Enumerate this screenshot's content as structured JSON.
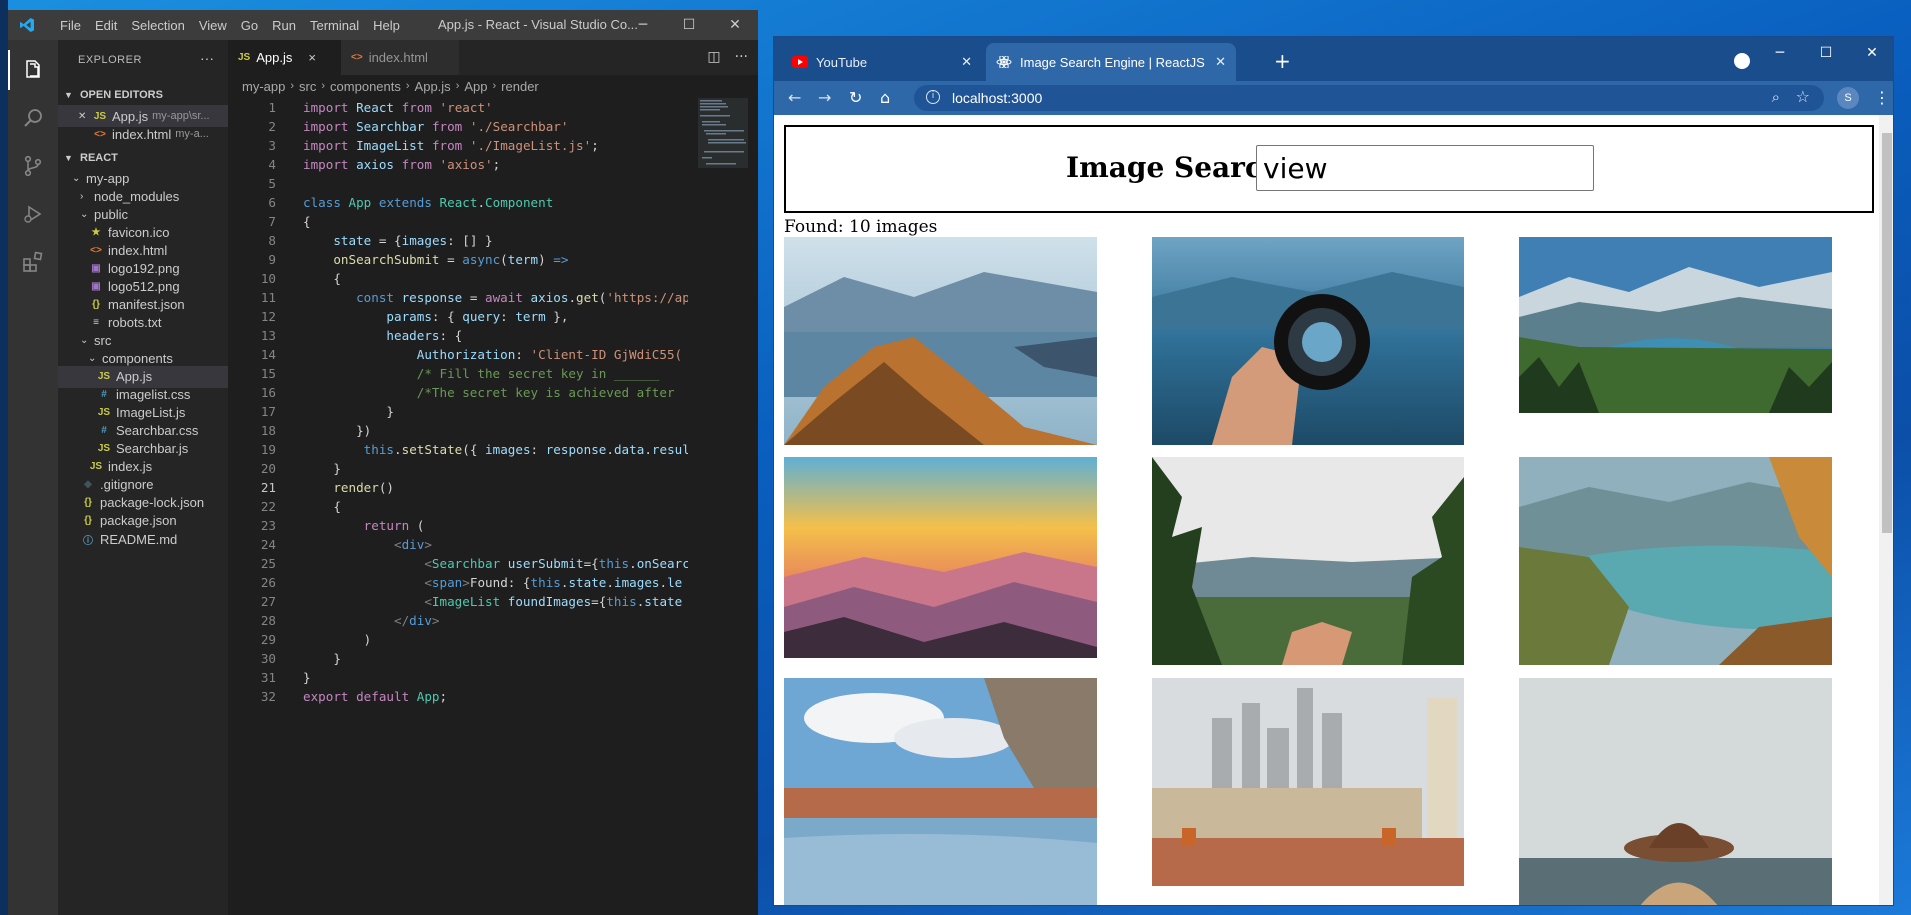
{
  "vscode": {
    "window_title": "App.js - React - Visual Studio Co...",
    "menu": [
      "File",
      "Edit",
      "Selection",
      "View",
      "Go",
      "Run",
      "Terminal",
      "Help"
    ],
    "explorer_header": "EXPLORER",
    "open_editors_header": "OPEN EDITORS",
    "open_editors": [
      {
        "name": "App.js",
        "path": "my-app\\sr...",
        "icon": "JS"
      },
      {
        "name": "index.html",
        "path": "my-a...",
        "icon": "<>"
      }
    ],
    "project_header": "REACT",
    "tree": [
      {
        "label": "my-app",
        "kind": "folder-open",
        "depth": 1
      },
      {
        "label": "node_modules",
        "kind": "folder",
        "depth": 2
      },
      {
        "label": "public",
        "kind": "folder-open",
        "depth": 2
      },
      {
        "label": "favicon.ico",
        "kind": "file",
        "icon": "★",
        "depth": 3
      },
      {
        "label": "index.html",
        "kind": "file",
        "icon": "<>",
        "depth": 3
      },
      {
        "label": "logo192.png",
        "kind": "file",
        "icon": "▣",
        "depth": 3
      },
      {
        "label": "logo512.png",
        "kind": "file",
        "icon": "▣",
        "depth": 3
      },
      {
        "label": "manifest.json",
        "kind": "file",
        "icon": "{}",
        "depth": 3
      },
      {
        "label": "robots.txt",
        "kind": "file",
        "icon": "≡",
        "depth": 3
      },
      {
        "label": "src",
        "kind": "folder-open",
        "depth": 2
      },
      {
        "label": "components",
        "kind": "folder-open",
        "depth": 3
      },
      {
        "label": "App.js",
        "kind": "file",
        "icon": "JS",
        "depth": 4,
        "selected": true
      },
      {
        "label": "imagelist.css",
        "kind": "file",
        "icon": "#",
        "depth": 4
      },
      {
        "label": "ImageList.js",
        "kind": "file",
        "icon": "JS",
        "depth": 4
      },
      {
        "label": "Searchbar.css",
        "kind": "file",
        "icon": "#",
        "depth": 4
      },
      {
        "label": "Searchbar.js",
        "kind": "file",
        "icon": "JS",
        "depth": 4
      },
      {
        "label": "index.js",
        "kind": "file",
        "icon": "JS",
        "depth": 3
      },
      {
        "label": ".gitignore",
        "kind": "file",
        "icon": "◆",
        "depth": 2
      },
      {
        "label": "package-lock.json",
        "kind": "file",
        "icon": "{}",
        "depth": 2
      },
      {
        "label": "package.json",
        "kind": "file",
        "icon": "{}",
        "depth": 2
      },
      {
        "label": "README.md",
        "kind": "file",
        "icon": "ⓘ",
        "depth": 2
      }
    ],
    "tabs": [
      {
        "label": "App.js",
        "icon": "JS",
        "active": true,
        "close": "×"
      },
      {
        "label": "index.html",
        "icon": "<>",
        "active": false
      }
    ],
    "breadcrumb": [
      "my-app",
      "src",
      "components",
      "App.js",
      "App",
      "render"
    ],
    "current_line": 21,
    "code": [
      [
        [
          "kw",
          "import"
        ],
        [
          "",
          " "
        ],
        [
          "var",
          "React"
        ],
        [
          "",
          " "
        ],
        [
          "kw",
          "from"
        ],
        [
          "",
          " "
        ],
        [
          "str",
          "'react'"
        ]
      ],
      [
        [
          "kw",
          "import"
        ],
        [
          "",
          " "
        ],
        [
          "var",
          "Searchbar"
        ],
        [
          "",
          " "
        ],
        [
          "kw",
          "from"
        ],
        [
          "",
          " "
        ],
        [
          "str",
          "'./Searchbar'"
        ]
      ],
      [
        [
          "kw",
          "import"
        ],
        [
          "",
          " "
        ],
        [
          "var",
          "ImageList"
        ],
        [
          "",
          " "
        ],
        [
          "kw",
          "from"
        ],
        [
          "",
          " "
        ],
        [
          "str",
          "'./ImageList.js'"
        ],
        [
          "",
          ";"
        ]
      ],
      [
        [
          "kw",
          "import"
        ],
        [
          "",
          " "
        ],
        [
          "var",
          "axios"
        ],
        [
          "",
          " "
        ],
        [
          "kw",
          "from"
        ],
        [
          "",
          " "
        ],
        [
          "str",
          "'axios'"
        ],
        [
          "",
          ";"
        ]
      ],
      [],
      [
        [
          "kw2",
          "class"
        ],
        [
          "",
          " "
        ],
        [
          "cls",
          "App"
        ],
        [
          "",
          " "
        ],
        [
          "kw2",
          "extends"
        ],
        [
          "",
          " "
        ],
        [
          "cls",
          "React"
        ],
        [
          "",
          "."
        ],
        [
          "cls",
          "Component"
        ]
      ],
      [
        [
          "",
          "{"
        ]
      ],
      [
        [
          "",
          "    "
        ],
        [
          "var",
          "state"
        ],
        [
          "",
          " = {"
        ],
        [
          "var",
          "images"
        ],
        [
          "",
          ": [] }"
        ]
      ],
      [
        [
          "",
          "    "
        ],
        [
          "fn",
          "onSearchSubmit"
        ],
        [
          "",
          " = "
        ],
        [
          "kw2",
          "async"
        ],
        [
          "",
          "("
        ],
        [
          "var",
          "term"
        ],
        [
          "",
          ") "
        ],
        [
          "kw2",
          "=>"
        ]
      ],
      [
        [
          "",
          "    {"
        ]
      ],
      [
        [
          "",
          "       "
        ],
        [
          "kw2",
          "const"
        ],
        [
          "",
          " "
        ],
        [
          "var",
          "response"
        ],
        [
          "",
          " = "
        ],
        [
          "kw",
          "await"
        ],
        [
          "",
          " "
        ],
        [
          "var",
          "axios"
        ],
        [
          "",
          "."
        ],
        [
          "fn",
          "get"
        ],
        [
          "",
          "("
        ],
        [
          "str",
          "'https://ap"
        ]
      ],
      [
        [
          "",
          "           "
        ],
        [
          "var",
          "params"
        ],
        [
          "",
          ": { "
        ],
        [
          "var",
          "query"
        ],
        [
          "",
          ": "
        ],
        [
          "var",
          "term"
        ],
        [
          "",
          " },"
        ]
      ],
      [
        [
          "",
          "           "
        ],
        [
          "var",
          "headers"
        ],
        [
          "",
          ": {"
        ]
      ],
      [
        [
          "",
          "               "
        ],
        [
          "var",
          "Authorization"
        ],
        [
          "",
          ": "
        ],
        [
          "str",
          "'Client-ID GjWdiC55("
        ]
      ],
      [
        [
          "",
          "               "
        ],
        [
          "cmt",
          "/* Fill the secret key in ______"
        ]
      ],
      [
        [
          "",
          "               "
        ],
        [
          "cmt",
          "/*The secret key is achieved after"
        ]
      ],
      [
        [
          "",
          "           }"
        ]
      ],
      [
        [
          "",
          "       })"
        ]
      ],
      [
        [
          "",
          "        "
        ],
        [
          "kw2",
          "this"
        ],
        [
          "",
          "."
        ],
        [
          "fn",
          "setState"
        ],
        [
          "",
          "({ "
        ],
        [
          "var",
          "images"
        ],
        [
          "",
          ": "
        ],
        [
          "var",
          "response"
        ],
        [
          "",
          "."
        ],
        [
          "var",
          "data"
        ],
        [
          "",
          "."
        ],
        [
          "var",
          "resul"
        ]
      ],
      [
        [
          "",
          "    }"
        ]
      ],
      [
        [
          "",
          "    "
        ],
        [
          "fn",
          "render"
        ],
        [
          "",
          "()"
        ]
      ],
      [
        [
          "",
          "    {"
        ]
      ],
      [
        [
          "",
          "        "
        ],
        [
          "kw",
          "return"
        ],
        [
          "",
          " ("
        ]
      ],
      [
        [
          "",
          "            "
        ],
        [
          "tag",
          "<"
        ],
        [
          "kw2",
          "div"
        ],
        [
          "tag",
          ">"
        ]
      ],
      [
        [
          "",
          "                "
        ],
        [
          "tag",
          "<"
        ],
        [
          "tn",
          "Searchbar"
        ],
        [
          "",
          " "
        ],
        [
          "var",
          "userSubmit"
        ],
        [
          "",
          "={"
        ],
        [
          "kw2",
          "this"
        ],
        [
          "",
          "."
        ],
        [
          "var",
          "onSearc"
        ]
      ],
      [
        [
          "",
          "                "
        ],
        [
          "tag",
          "<"
        ],
        [
          "kw2",
          "span"
        ],
        [
          "tag",
          ">"
        ],
        [
          "",
          "Found: {"
        ],
        [
          "kw2",
          "this"
        ],
        [
          "",
          "."
        ],
        [
          "var",
          "state"
        ],
        [
          "",
          "."
        ],
        [
          "var",
          "images"
        ],
        [
          "",
          "."
        ],
        [
          "var",
          "le"
        ]
      ],
      [
        [
          "",
          "                "
        ],
        [
          "tag",
          "<"
        ],
        [
          "tn",
          "ImageList"
        ],
        [
          "",
          " "
        ],
        [
          "var",
          "foundImages"
        ],
        [
          "",
          "={"
        ],
        [
          "kw2",
          "this"
        ],
        [
          "",
          "."
        ],
        [
          "var",
          "state"
        ]
      ],
      [
        [
          "",
          "            "
        ],
        [
          "tag",
          "</"
        ],
        [
          "kw2",
          "div"
        ],
        [
          "tag",
          ">"
        ]
      ],
      [
        [
          "",
          "        )"
        ]
      ],
      [
        [
          "",
          "    }"
        ]
      ],
      [
        [
          "",
          "}"
        ]
      ],
      [
        [
          "kw",
          "export"
        ],
        [
          "",
          " "
        ],
        [
          "kw",
          "default"
        ],
        [
          "",
          " "
        ],
        [
          "cls",
          "App"
        ],
        [
          "",
          ";"
        ]
      ]
    ]
  },
  "chrome": {
    "tabs": [
      {
        "label": "YouTube",
        "active": false
      },
      {
        "label": "Image Search Engine | ReactJS",
        "active": true
      }
    ],
    "new_tab": "+",
    "url": "localhost:3000",
    "profile_initial": "S",
    "page": {
      "heading": "Image Search",
      "search_value": "view",
      "found_text": "Found: 10 images",
      "images": [
        {
          "name": "mountain-lake-image"
        },
        {
          "name": "lens-hand-image"
        },
        {
          "name": "alpine-valley-image"
        },
        {
          "name": "sunset-ridges-image"
        },
        {
          "name": "forest-hand-image"
        },
        {
          "name": "turquoise-lake-image"
        },
        {
          "name": "river-town-image"
        },
        {
          "name": "rooftop-city-image"
        },
        {
          "name": "hat-woman-image"
        }
      ]
    }
  }
}
